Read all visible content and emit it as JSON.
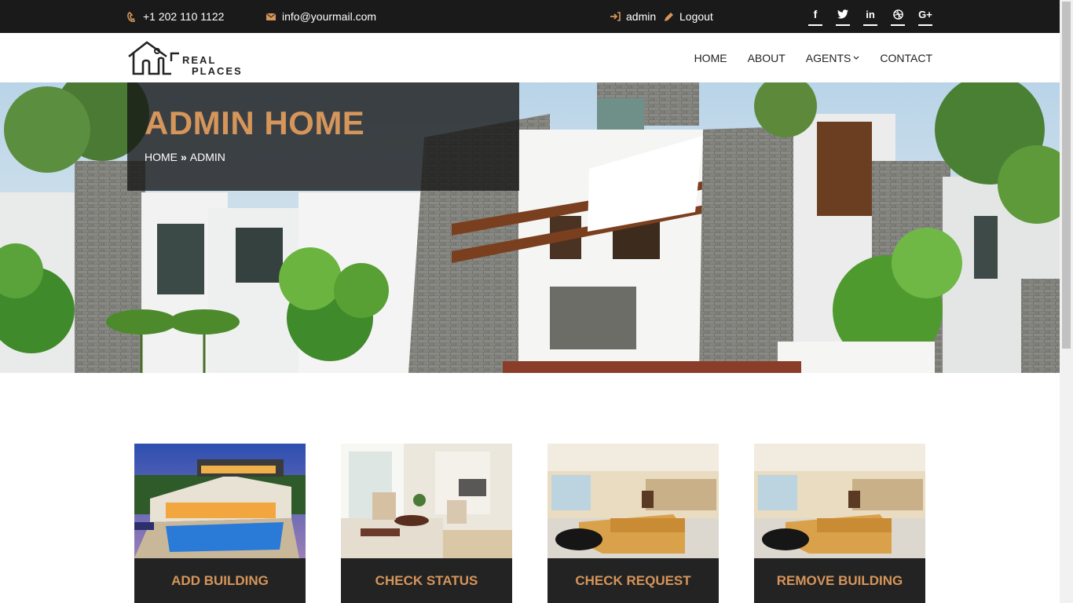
{
  "topbar": {
    "phone": "+1 202 110 1122",
    "email": "info@yourmail.com",
    "user": "admin",
    "logout": "Logout",
    "social": [
      {
        "name": "facebook",
        "glyph": "f"
      },
      {
        "name": "twitter",
        "glyph": "t"
      },
      {
        "name": "linkedin",
        "glyph": "in"
      },
      {
        "name": "dribbble",
        "glyph": "◍"
      },
      {
        "name": "google-plus",
        "glyph": "G+"
      }
    ]
  },
  "header": {
    "logo_text_1": "REAL",
    "logo_text_2": "PLACES",
    "nav": [
      {
        "label": "HOME"
      },
      {
        "label": "ABOUT"
      },
      {
        "label": "AGENTS",
        "dropdown": true
      },
      {
        "label": "CONTACT"
      }
    ]
  },
  "hero": {
    "title": "ADMIN HOME",
    "breadcrumb_home": "HOME",
    "breadcrumb_sep": "»",
    "breadcrumb_current": "ADMIN"
  },
  "cards": [
    {
      "label": "ADD BUILDING"
    },
    {
      "label": "CHECK STATUS"
    },
    {
      "label": "CHECK REQUEST"
    },
    {
      "label": "REMOVE BUILDING"
    }
  ],
  "colors": {
    "accent": "#d6955a",
    "dark": "#1a1a1a",
    "card_bg": "#232323"
  }
}
